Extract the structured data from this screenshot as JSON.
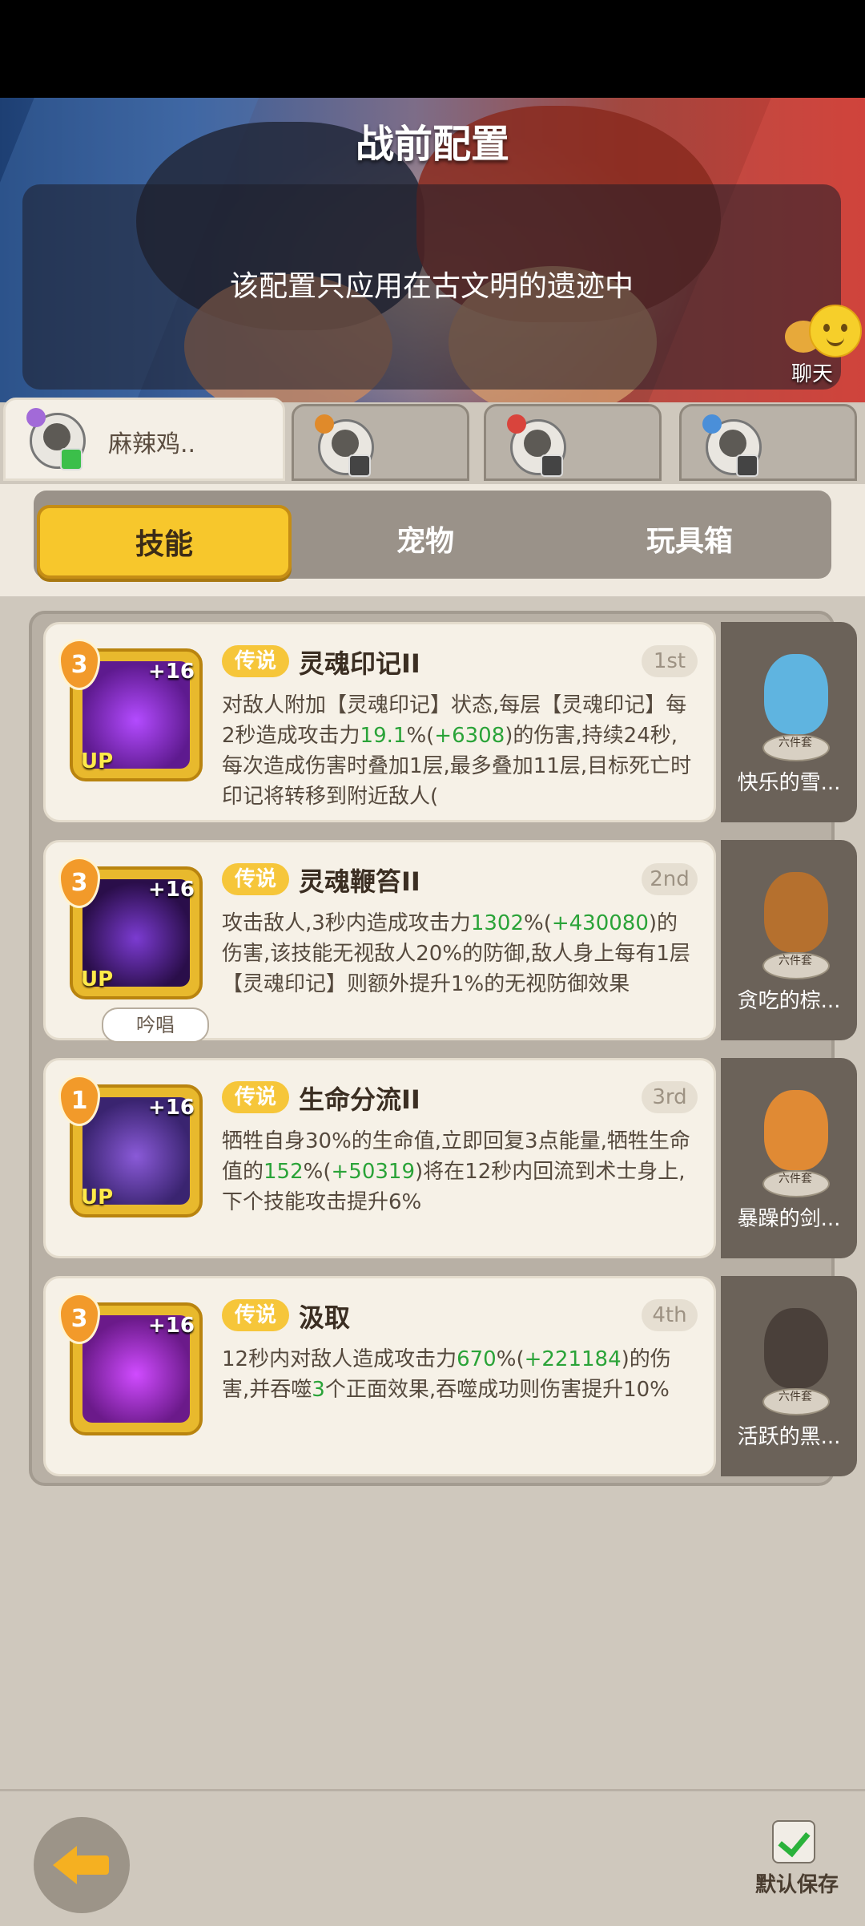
{
  "header": {
    "title": "战前配置",
    "notice": "该配置只应用在古文明的遗迹中",
    "chat_label": "聊天"
  },
  "characters": [
    {
      "name": "麻辣鸡..",
      "active": true,
      "elem_color": "#a26ad8"
    },
    {
      "name": "",
      "active": false,
      "elem_color": "#e08a2a"
    },
    {
      "name": "",
      "active": false,
      "elem_color": "#d9443c"
    },
    {
      "name": "",
      "active": false,
      "elem_color": "#4a8fd9"
    }
  ],
  "category_tabs": [
    "技能",
    "宠物",
    "玩具箱"
  ],
  "skills": [
    {
      "level": "3",
      "plus": "+16",
      "up": "UP",
      "tag": "传说",
      "name": "灵魂印记II",
      "rank": "1st",
      "desc": [
        {
          "t": "对敌人附加【灵魂印记】状态,每层【灵魂印记】每2秒造成攻击力"
        },
        {
          "t": "19.1",
          "hl": true
        },
        {
          "t": "%("
        },
        {
          "t": "+6308",
          "hl": true
        },
        {
          "t": ")的伤害,持续24秒,每次造成伤害时叠加1层,最多叠加11层,目标死亡时印记将转移到附近敌人("
        }
      ],
      "icon_colors": [
        "#5e1a8f",
        "#b34bff"
      ]
    },
    {
      "level": "3",
      "plus": "+16",
      "up": "UP",
      "tag": "传说",
      "name": "灵魂鞭笞II",
      "rank": "2nd",
      "chant": "吟唱",
      "desc": [
        {
          "t": "攻击敌人,3秒内造成攻击力"
        },
        {
          "t": "1302",
          "hl": true
        },
        {
          "t": "%("
        },
        {
          "t": "+430080",
          "hl": true
        },
        {
          "t": ")的伤害,该技能无视敌人20%的防御,敌人身上每有1层【灵魂印记】则额外提升1%的无视防御效果"
        }
      ],
      "icon_colors": [
        "#2a0e4a",
        "#7b3bd1"
      ]
    },
    {
      "level": "1",
      "plus": "+16",
      "up": "UP",
      "tag": "传说",
      "name": "生命分流II",
      "rank": "3rd",
      "desc": [
        {
          "t": "牺牲自身30%的生命值,立即回复3点能量,牺牲生命值的"
        },
        {
          "t": "152",
          "hl": true
        },
        {
          "t": "%("
        },
        {
          "t": "+50319",
          "hl": true
        },
        {
          "t": ")将在12秒内回流到术士身上,下个技能攻击提升6%"
        }
      ],
      "icon_colors": [
        "#3a2470",
        "#8a5ad8"
      ]
    },
    {
      "level": "3",
      "plus": "+16",
      "up": "",
      "tag": "传说",
      "name": "汲取",
      "rank": "4th",
      "desc": [
        {
          "t": "12秒内对敌人造成攻击力"
        },
        {
          "t": "670",
          "hl": true
        },
        {
          "t": "%("
        },
        {
          "t": "+221184",
          "hl": true
        },
        {
          "t": ")的伤害,并吞噬"
        },
        {
          "t": "3",
          "hl": true
        },
        {
          "t": "个正面效果,吞噬成功则伤害提升10%"
        }
      ],
      "icon_colors": [
        "#6b1a8a",
        "#d04bff"
      ]
    }
  ],
  "pets": [
    {
      "name": "快乐的雪...",
      "base": "六件套",
      "color": "#5fb4e0"
    },
    {
      "name": "贪吃的棕...",
      "base": "六件套",
      "color": "#b5702e"
    },
    {
      "name": "暴躁的剑...",
      "base": "六件套",
      "color": "#e08a34"
    },
    {
      "name": "活跃的黑...",
      "base": "六件套",
      "color": "#4a403a"
    }
  ],
  "bottom": {
    "save_label": "默认保存"
  }
}
